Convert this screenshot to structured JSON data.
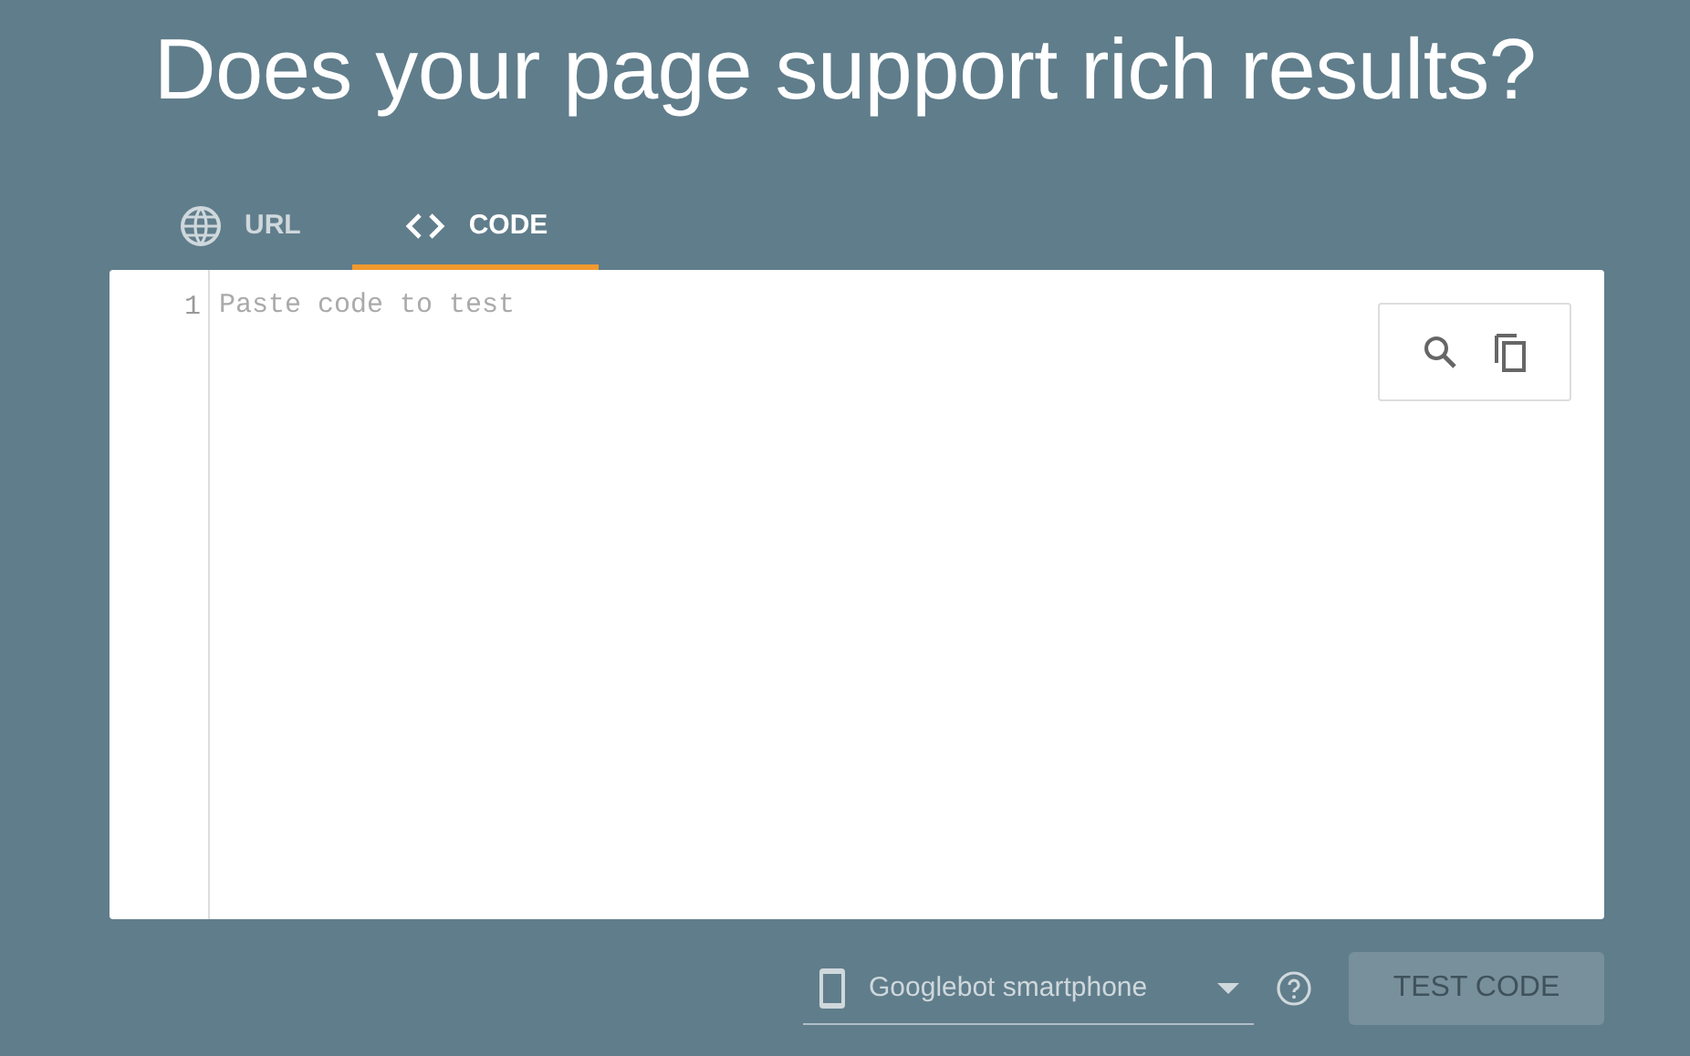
{
  "title": "Does your page support rich results?",
  "tabs": [
    {
      "label": "URL",
      "kind": "globe",
      "selected": false
    },
    {
      "label": "CODE",
      "kind": "code",
      "selected": true
    }
  ],
  "editor": {
    "line_numbers": [
      "1"
    ],
    "placeholder": "Paste code to test"
  },
  "device_select": {
    "value": "Googlebot smartphone"
  },
  "test_button": {
    "label": "TEST CODE",
    "disabled": true
  }
}
